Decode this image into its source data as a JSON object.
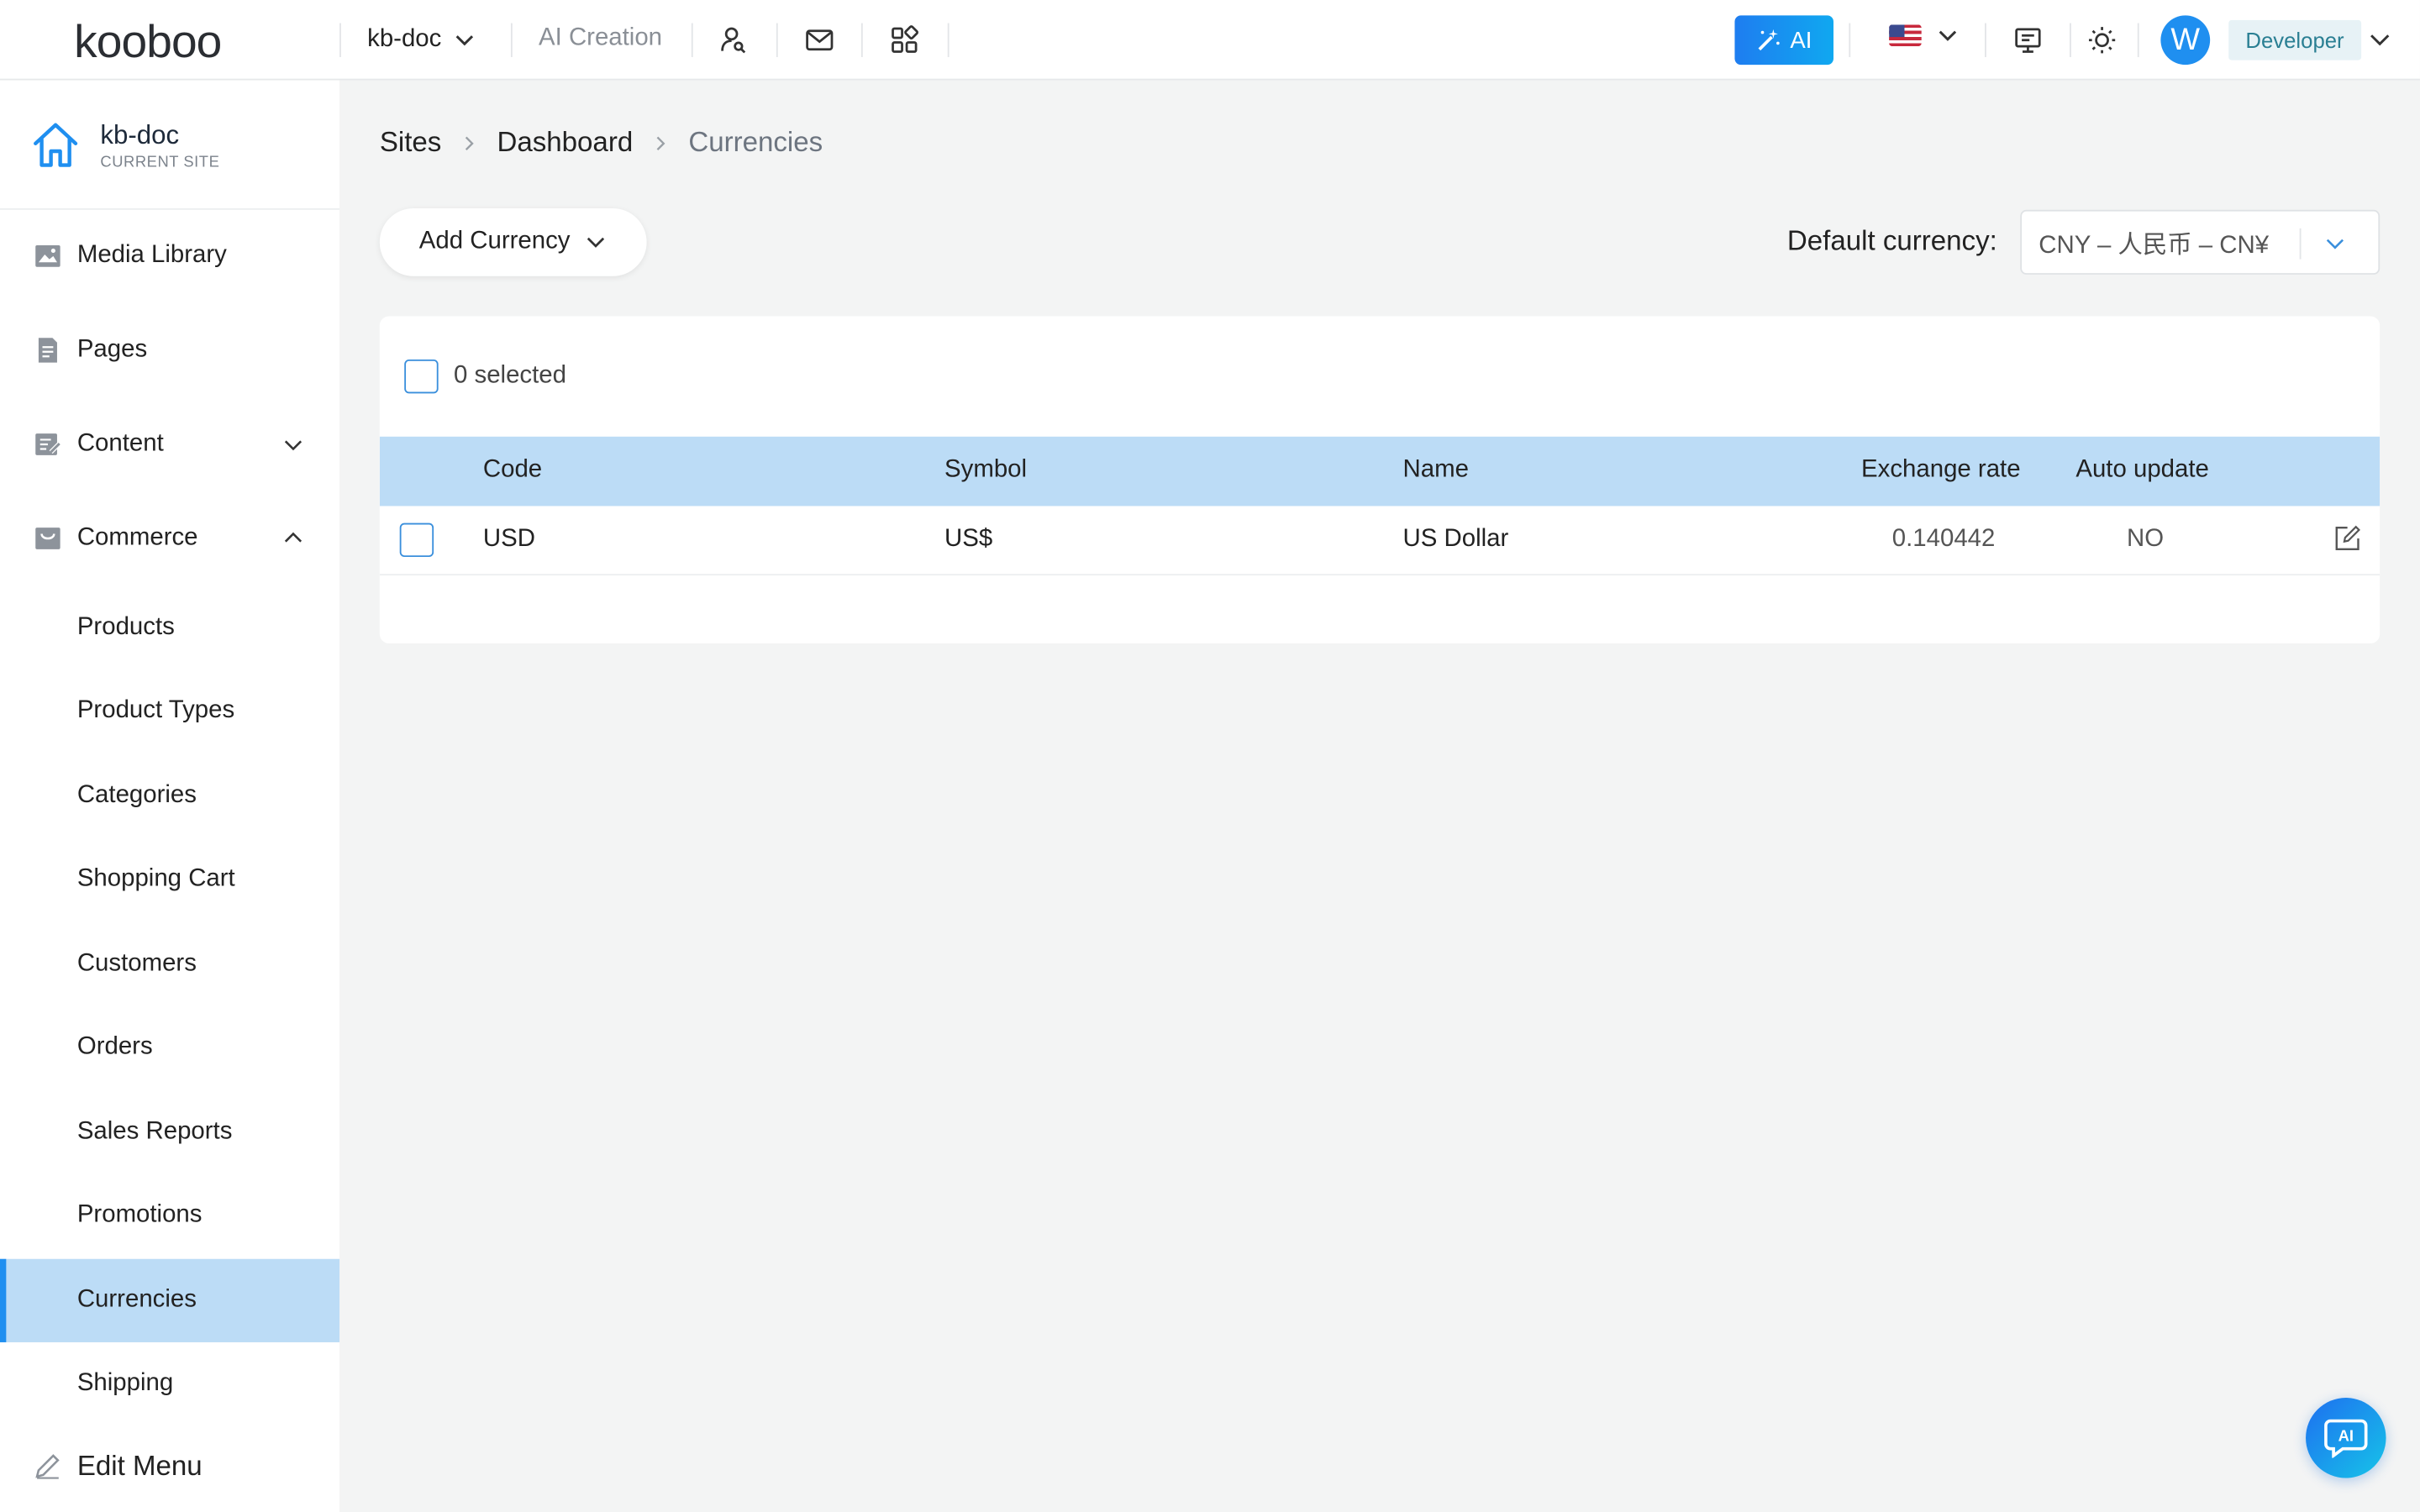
{
  "header": {
    "logo_text": "kooboo",
    "site_selector": "kb-doc",
    "ai_creation": "AI Creation",
    "ai_button": "AI",
    "user_initial": "W",
    "role": "Developer",
    "icons": [
      "user-search-icon",
      "mail-icon",
      "apps-icon",
      "monitor-icon",
      "sun-icon"
    ],
    "language_flag": "us-flag"
  },
  "sidebar": {
    "site_name": "kb-doc",
    "site_subtitle": "CURRENT SITE",
    "items": [
      {
        "label": "Media Library",
        "icon": "image-icon"
      },
      {
        "label": "Pages",
        "icon": "page-icon"
      },
      {
        "label": "Content",
        "icon": "content-icon",
        "expandable": true,
        "expanded": false
      },
      {
        "label": "Commerce",
        "icon": "commerce-icon",
        "expandable": true,
        "expanded": true
      }
    ],
    "commerce_sub": [
      "Products",
      "Product Types",
      "Categories",
      "Shopping Cart",
      "Customers",
      "Orders",
      "Sales Reports",
      "Promotions",
      "Currencies",
      "Shipping"
    ],
    "active_item": "Currencies",
    "edit_menu": "Edit Menu"
  },
  "breadcrumb": [
    "Sites",
    "Dashboard",
    "Currencies"
  ],
  "toolbar": {
    "add_button": "Add Currency",
    "default_label": "Default currency:",
    "default_value": "CNY – 人民币 – CN¥"
  },
  "table": {
    "selected_text": "0 selected",
    "columns": [
      "Code",
      "Symbol",
      "Name",
      "Exchange rate",
      "Auto update"
    ],
    "rows": [
      {
        "code": "USD",
        "symbol": "US$",
        "name": "US Dollar",
        "rate": "0.140442",
        "auto": "NO"
      }
    ]
  },
  "colors": {
    "accent": "#1f8ff0",
    "active_bg": "#bcdcf6",
    "header_bg": "#bcdcf6",
    "page_bg": "#f3f4f4"
  }
}
